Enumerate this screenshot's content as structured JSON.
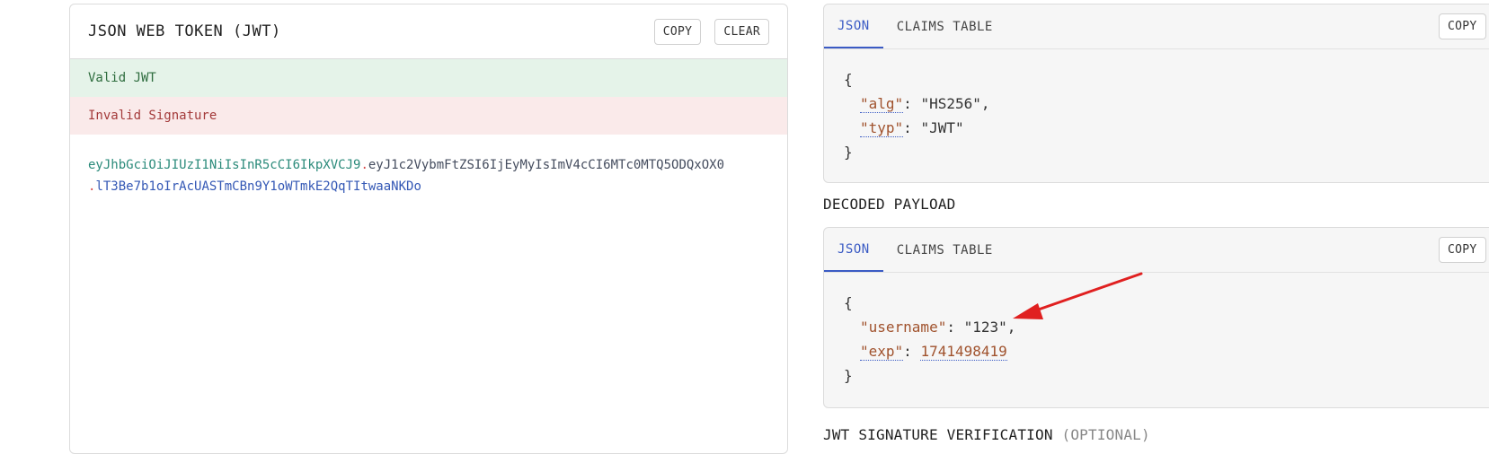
{
  "encoded": {
    "title": "JSON WEB TOKEN (JWT)",
    "copy_label": "COPY",
    "clear_label": "CLEAR",
    "status_valid": "Valid JWT",
    "status_signature": "Invalid Signature",
    "token_header": "eyJhbGciOiJIUzI1NiIsInR5cCI6IkpXVCJ9",
    "token_payload": "eyJ1c2VybmFtZSI6IjEyMyIsImV4cCI6MTc0MTQ5ODQxOX0",
    "token_signature": "lT3Be7b1oIrAcUASTmCBn9Y1oWTmkE2QqTItwaaNKDo",
    "dot": "."
  },
  "decoded_header": {
    "tab_json": "JSON",
    "tab_claims": "CLAIMS TABLE",
    "copy_label": "COPY",
    "open_brace": "{",
    "close_brace": "}",
    "alg_key": "\"alg\"",
    "alg_value": "\"HS256\"",
    "typ_key": "\"typ\"",
    "typ_value": "\"JWT\""
  },
  "decoded_payload": {
    "section_title": "DECODED PAYLOAD",
    "tab_json": "JSON",
    "tab_claims": "CLAIMS TABLE",
    "copy_label": "COPY",
    "open_brace": "{",
    "close_brace": "}",
    "username_key": "\"username\"",
    "username_value": "\"123\"",
    "exp_key": "\"exp\"",
    "exp_value": "1741498419"
  },
  "signature_section": {
    "title": "JWT SIGNATURE VERIFICATION",
    "optional": "(OPTIONAL)"
  },
  "colors": {
    "accent": "#3b5bc4",
    "valid_bg": "#e5f3e9",
    "invalid_bg": "#faeaea",
    "arrow": "#e02020"
  },
  "icons": [
    "annotation-arrow-icon"
  ]
}
